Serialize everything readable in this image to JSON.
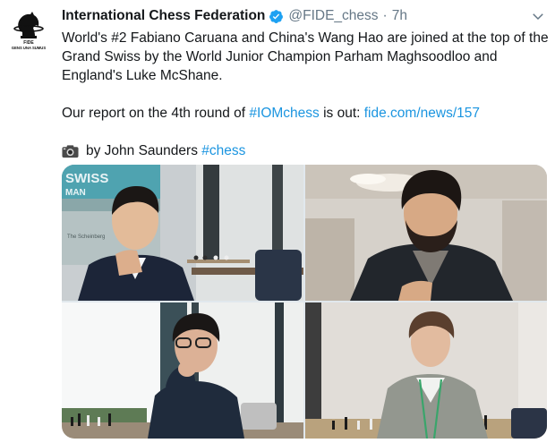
{
  "tweet": {
    "author_name": "International Chess Federation",
    "handle": "@FIDE_chess",
    "separator": "·",
    "time": "7h",
    "paragraph1": "World's #2 Fabiano Caruana and China's Wang Hao are joined at the top of the Grand Swiss by the World Junior Champion Parham Maghsoodloo and England's Luke McShane.",
    "paragraph2_prefix": "Our report on the 4th round of ",
    "paragraph2_hashtag": "#IOMchess",
    "paragraph2_middle": " is out: ",
    "paragraph2_link": "fide.com/news/157",
    "credit_text": "by John Saunders ",
    "credit_hashtag": "#chess"
  },
  "avatar": {
    "logo_name": "FIDE",
    "motto": "GENS UNA SUMUS"
  },
  "photos": {
    "banner_top": "SWISS",
    "banner_bottom": "MAN",
    "sponsor_text": "The Scheinberg"
  },
  "colors": {
    "link": "#1b95e0",
    "verified": "#1da1f2",
    "secondary_text": "#657786"
  },
  "icons": [
    "fide-logo-icon",
    "verified-badge-icon",
    "chevron-down-icon",
    "camera-icon"
  ]
}
